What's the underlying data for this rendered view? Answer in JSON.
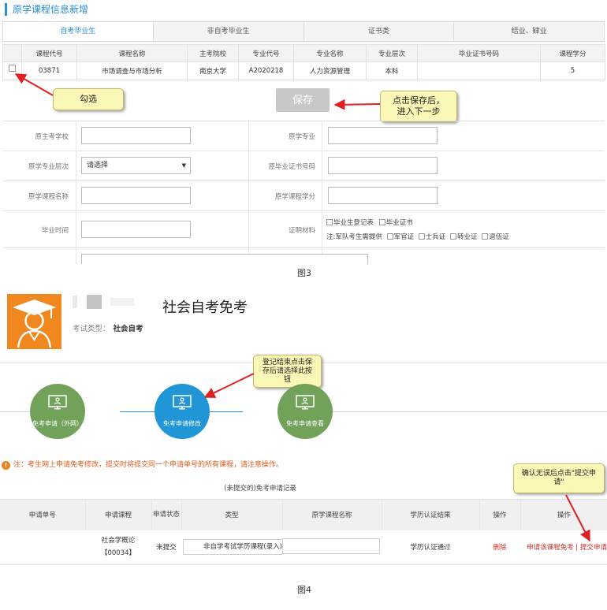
{
  "fig3": {
    "section_title": "原学课程信息新增",
    "tabs": [
      "自考毕业生",
      "非自考毕业生",
      "证书类",
      "结业、肄业"
    ],
    "course_table": {
      "headers": [
        "课程代号",
        "课程名称",
        "主考院校",
        "专业代号",
        "专业名称",
        "专业层次",
        "毕业证书号码",
        "课程学分"
      ],
      "row": [
        "03871",
        "市场调查与市场分析",
        "南京大学",
        "A2020218",
        "人力资源管理",
        "本科",
        "",
        "5"
      ]
    },
    "callout_check": "勾选",
    "save_button": "保存",
    "callout_save": "点击保存后，\n进入下一步",
    "form": {
      "school_label": "原主考学校",
      "major_label": "原学专业",
      "level_label": "原学专业层次",
      "level_value": "请选择",
      "cert_no_label": "原毕业证书号码",
      "course_name_label": "原学课程名称",
      "course_credit_label": "原学课程学分",
      "grad_time_label": "毕业时间",
      "material_label": "证明材料",
      "materials_line1": [
        "毕业生登记表",
        "毕业证书"
      ],
      "materials_note": "注:军队考生需提供",
      "materials_line2": [
        "军官证",
        "士兵证",
        "转业证",
        "退伍证"
      ]
    },
    "caption": "图3"
  },
  "fig4": {
    "page_title": "社会自考免考",
    "exam_type_label": "考试类型：",
    "exam_type_value": "社会自考",
    "callout_register": "登记结束点击保\n存后请选择此按\n钮",
    "steps": [
      "免考申请（外网）",
      "免考申请修改",
      "免考申请查看"
    ],
    "notice": "注：考生网上申请免考修改，提交时将提交同一个申请单号的所有课程，请注意操作。",
    "callout_confirm": "确认无误后点击\"提交申\n请\"",
    "record_table": {
      "caption": "(未提交的)免考申请记录",
      "headers": [
        "申请单号",
        "申请课程",
        "申请状态",
        "类型",
        "原学课程名称",
        "学历认证结果",
        "操作",
        "操作"
      ],
      "row": {
        "order_no": "",
        "course_name": "社会学概论",
        "course_code": "【00034】",
        "status": "未提交",
        "type": "非自学考试学历课程(录入)",
        "orig_course": "",
        "cert_result": "学历认证通过",
        "op_delete": "删除",
        "op_apply": "申请该课程免考",
        "op_sep": " | ",
        "op_submit": "提交申请"
      }
    },
    "caption": "图4"
  },
  "colors": {
    "accent": "#2a8fd6",
    "step_green": "#72a159",
    "step_blue": "#2196d6",
    "logo_orange": "#f0871f",
    "callout": "#fbf7b6",
    "arrow": "#e02020"
  }
}
